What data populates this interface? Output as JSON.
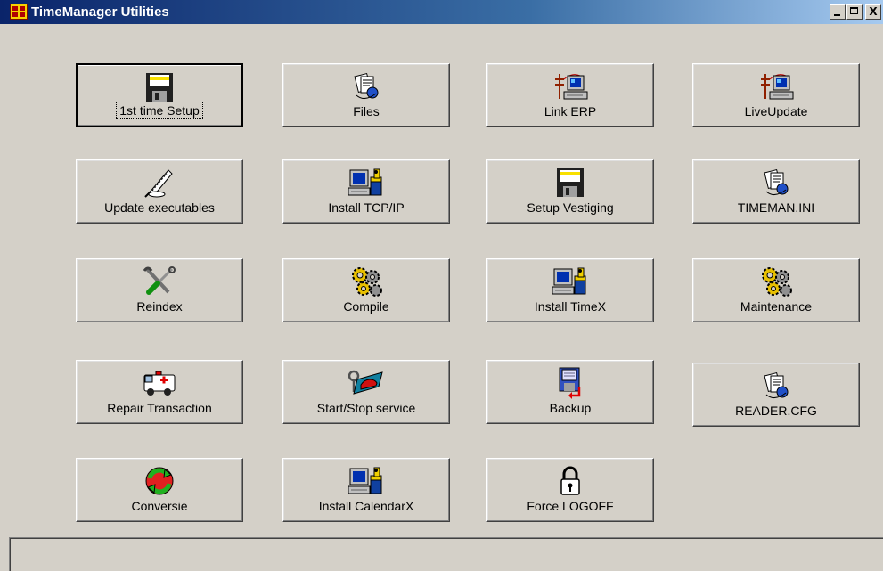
{
  "window": {
    "title": "TimeManager Utilities",
    "controls": {
      "minimize": "_",
      "maximize": "□",
      "close": "X"
    }
  },
  "buttons": [
    {
      "label": "1st time Setup",
      "icon": "floppy-disk-icon",
      "default": true
    },
    {
      "label": "Files",
      "icon": "documents-icon"
    },
    {
      "label": "Link ERP",
      "icon": "network-computer-icon"
    },
    {
      "label": "LiveUpdate",
      "icon": "network-computer-icon"
    },
    {
      "label": "Update executables",
      "icon": "quill-pen-icon"
    },
    {
      "label": "Install TCP/IP",
      "icon": "computer-setup-icon"
    },
    {
      "label": "Setup Vestiging",
      "icon": "floppy-disk-icon"
    },
    {
      "label": "TIMEMAN.INI",
      "icon": "documents-icon"
    },
    {
      "label": "Reindex",
      "icon": "tools-icon"
    },
    {
      "label": "Compile",
      "icon": "gears-icon"
    },
    {
      "label": "Install TimeX",
      "icon": "computer-setup-icon"
    },
    {
      "label": "Maintenance",
      "icon": "gears-icon"
    },
    {
      "label": "Repair Transaction",
      "icon": "ambulance-icon"
    },
    {
      "label": "Start/Stop service",
      "icon": "key-car-icon"
    },
    {
      "label": "Backup",
      "icon": "backup-disk-icon"
    },
    {
      "label": "READER.CFG",
      "icon": "documents-icon"
    },
    {
      "label": "Conversie",
      "icon": "refresh-arrows-icon"
    },
    {
      "label": "Install CalendarX",
      "icon": "computer-setup-icon"
    },
    {
      "label": "Force LOGOFF",
      "icon": "padlock-icon"
    }
  ],
  "colors": {
    "face": "#d4d0c8",
    "title_start": "#0a246a",
    "title_end": "#a6caf0"
  }
}
